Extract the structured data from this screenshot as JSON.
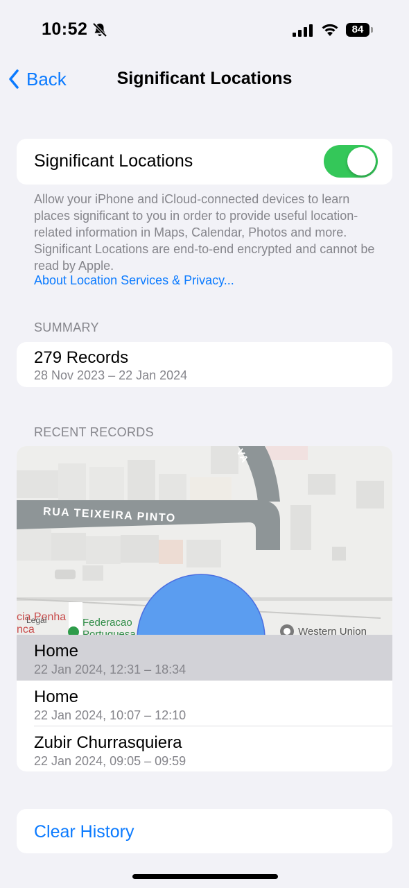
{
  "status_bar": {
    "time": "10:52",
    "battery": "84"
  },
  "nav": {
    "back_label": "Back",
    "title": "Significant Locations"
  },
  "toggle": {
    "label": "Significant Locations",
    "on": true,
    "color": "#34c759"
  },
  "footer": {
    "text": "Allow your iPhone and iCloud-connected devices to learn places significant to you in order to provide useful location-related information in Maps, Calendar, Photos and more. Significant Locations are end-to-end encrypted and cannot be read by Apple.",
    "link": "About Location Services & Privacy..."
  },
  "summary": {
    "header": "SUMMARY",
    "title": "279 Records",
    "range": "28 Nov 2023 – 22 Jan 2024"
  },
  "recent": {
    "header": "RECENT RECORDS",
    "map": {
      "street_label": "RUA TEIXEIRA PINTO",
      "poi_left": "cia Penha",
      "poi_left_2": "nca",
      "poi_legal": "Legal",
      "poi_green": "Federacao",
      "poi_green_2": "Portuguesa",
      "poi_right": "Western Union",
      "street_top": "VA"
    },
    "records": [
      {
        "title": "Home",
        "time": "22 Jan 2024, 12:31 – 18:34",
        "selected": true
      },
      {
        "title": "Home",
        "time": "22 Jan 2024, 10:07 – 12:10",
        "selected": false
      },
      {
        "title": "Zubir Churrasquiera",
        "time": "22 Jan 2024, 09:05 – 09:59",
        "selected": false
      }
    ]
  },
  "clear_history_label": "Clear History",
  "colors": {
    "accent": "#0a7aff",
    "region": "#5b9df0"
  }
}
